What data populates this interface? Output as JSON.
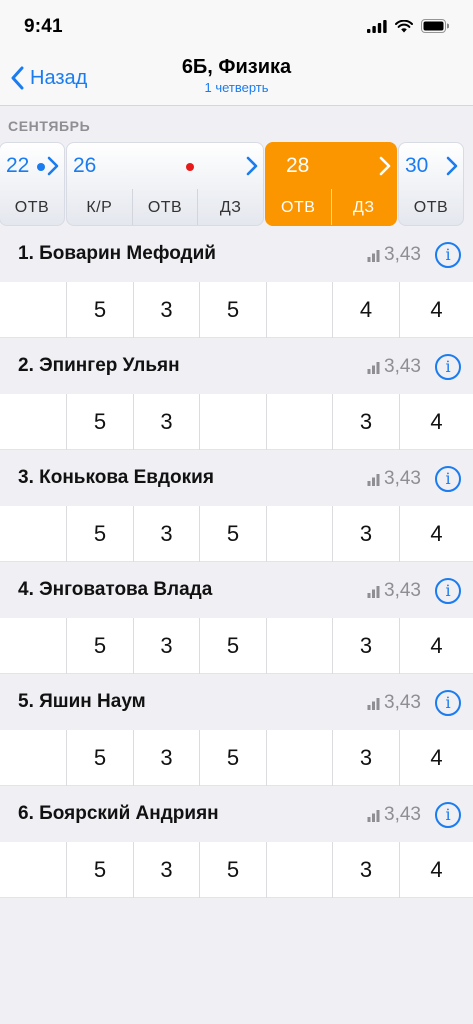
{
  "status": {
    "time": "9:41"
  },
  "nav": {
    "back_label": "Назад",
    "title": "6Б, Физика",
    "subtitle": "1 четверть"
  },
  "month": "СЕНТЯБРЬ",
  "colors": {
    "accent": "#1a7cf0",
    "active": "#fb9500",
    "dot_blue": "#1a7cf0",
    "dot_red": "#e81b1b"
  },
  "dates": [
    {
      "num": "22",
      "dot": "blue",
      "types": [
        "ОТВ"
      ]
    },
    {
      "num": "26",
      "dot": "red",
      "types": [
        "К/Р",
        "ОТВ",
        "ДЗ"
      ]
    },
    {
      "num": "28",
      "dot": "",
      "types": [
        "ОТВ",
        "ДЗ"
      ],
      "active": true
    },
    {
      "num": "30",
      "dot": "",
      "types": [
        "ОТВ"
      ]
    }
  ],
  "students": [
    {
      "name": "1. Боварин Мефодий",
      "avg": "3,43",
      "grades": [
        "",
        "5",
        "3",
        "5",
        "",
        "4",
        "4"
      ]
    },
    {
      "name": "2. Эпингер Ульян",
      "avg": "3,43",
      "grades": [
        "",
        "5",
        "3",
        "",
        "",
        "3",
        "4"
      ]
    },
    {
      "name": "3. Конькова Евдокия",
      "avg": "3,43",
      "grades": [
        "",
        "5",
        "3",
        "5",
        "",
        "3",
        "4"
      ]
    },
    {
      "name": "4. Энговатова Влада",
      "avg": "3,43",
      "grades": [
        "",
        "5",
        "3",
        "5",
        "",
        "3",
        "4"
      ]
    },
    {
      "name": "5. Яшин Наум",
      "avg": "3,43",
      "grades": [
        "",
        "5",
        "3",
        "5",
        "",
        "3",
        "4"
      ]
    },
    {
      "name": "6. Боярский Андриян",
      "avg": "3,43",
      "grades": [
        "",
        "5",
        "3",
        "5",
        "",
        "3",
        "4"
      ]
    }
  ]
}
